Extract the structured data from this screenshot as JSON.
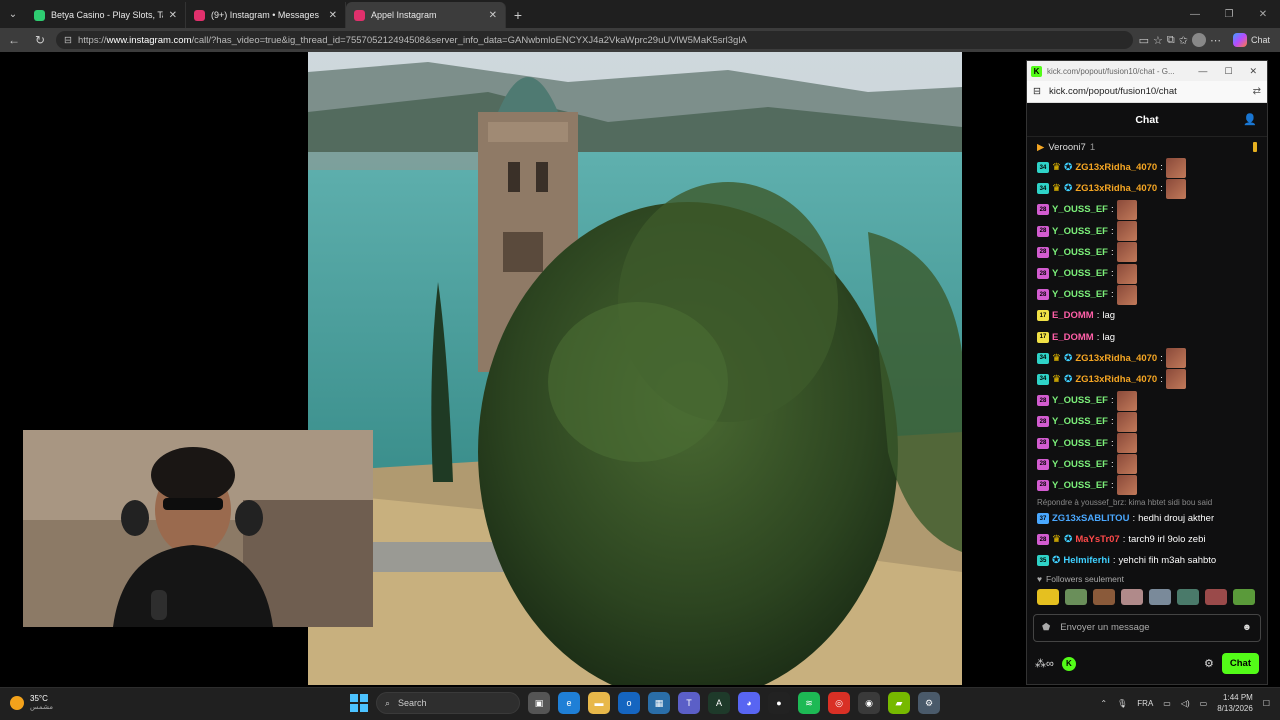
{
  "browser": {
    "tabs": [
      {
        "title": "Betya Casino - Play Slots, Table &",
        "favicon_color": "#2ecc71"
      },
      {
        "title": "(9+) Instagram • Messages",
        "favicon_color": "#e1306c"
      },
      {
        "title": "Appel Instagram",
        "favicon_color": "#e1306c"
      }
    ],
    "url_scheme": "https://",
    "url_host": "www.instagram.com",
    "url_path": "/call/?has_video=true&ig_thread_id=755705212494508&server_info_data=GANwbmloENCYXJ4a2VkaWprc29uUVlW5MaK5srl3glA",
    "copilot_label": "Chat"
  },
  "kick": {
    "window_title": "kick.com/popout/fusion10/chat - G...",
    "url": "kick.com/popout/fusion10/chat",
    "chat_title": "Chat",
    "pinned_user": "Verooni7",
    "pinned_count": "1",
    "messages": [
      {
        "badge": "34",
        "badge_color": "#2fd3c8",
        "crown": true,
        "shield": true,
        "user": "ZG13xRidha_4070",
        "color": "#f5a623",
        "text": "",
        "emote": true
      },
      {
        "badge": "34",
        "badge_color": "#2fd3c8",
        "crown": true,
        "shield": true,
        "user": "ZG13xRidha_4070",
        "color": "#f5a623",
        "text": "",
        "emote": true
      },
      {
        "badge": "28",
        "badge_color": "#d35cd0",
        "crown": false,
        "shield": false,
        "user": "Y_OUSS_EF",
        "color": "#7cf07a",
        "text": "",
        "emote": true
      },
      {
        "badge": "28",
        "badge_color": "#d35cd0",
        "crown": false,
        "shield": false,
        "user": "Y_OUSS_EF",
        "color": "#7cf07a",
        "text": "",
        "emote": true
      },
      {
        "badge": "28",
        "badge_color": "#d35cd0",
        "crown": false,
        "shield": false,
        "user": "Y_OUSS_EF",
        "color": "#7cf07a",
        "text": "",
        "emote": true
      },
      {
        "badge": "28",
        "badge_color": "#d35cd0",
        "crown": false,
        "shield": false,
        "user": "Y_OUSS_EF",
        "color": "#7cf07a",
        "text": "",
        "emote": true
      },
      {
        "badge": "28",
        "badge_color": "#d35cd0",
        "crown": false,
        "shield": false,
        "user": "Y_OUSS_EF",
        "color": "#7cf07a",
        "text": "",
        "emote": true
      },
      {
        "badge": "17",
        "badge_color": "#f0e046",
        "crown": false,
        "shield": false,
        "user": "E_DOMM",
        "color": "#ff5fa8",
        "text": "lag",
        "emote": false
      },
      {
        "badge": "17",
        "badge_color": "#f0e046",
        "crown": false,
        "shield": false,
        "user": "E_DOMM",
        "color": "#ff5fa8",
        "text": "lag",
        "emote": false
      },
      {
        "badge": "34",
        "badge_color": "#2fd3c8",
        "crown": true,
        "shield": true,
        "user": "ZG13xRidha_4070",
        "color": "#f5a623",
        "text": "",
        "emote": true
      },
      {
        "badge": "34",
        "badge_color": "#2fd3c8",
        "crown": true,
        "shield": true,
        "user": "ZG13xRidha_4070",
        "color": "#f5a623",
        "text": "",
        "emote": true
      },
      {
        "badge": "28",
        "badge_color": "#d35cd0",
        "crown": false,
        "shield": false,
        "user": "Y_OUSS_EF",
        "color": "#7cf07a",
        "text": "",
        "emote": true
      },
      {
        "badge": "28",
        "badge_color": "#d35cd0",
        "crown": false,
        "shield": false,
        "user": "Y_OUSS_EF",
        "color": "#7cf07a",
        "text": "",
        "emote": true
      },
      {
        "badge": "28",
        "badge_color": "#d35cd0",
        "crown": false,
        "shield": false,
        "user": "Y_OUSS_EF",
        "color": "#7cf07a",
        "text": "",
        "emote": true
      },
      {
        "badge": "28",
        "badge_color": "#d35cd0",
        "crown": false,
        "shield": false,
        "user": "Y_OUSS_EF",
        "color": "#7cf07a",
        "text": "",
        "emote": true
      },
      {
        "badge": "28",
        "badge_color": "#d35cd0",
        "crown": false,
        "shield": false,
        "user": "Y_OUSS_EF",
        "color": "#7cf07a",
        "text": "",
        "emote": true
      }
    ],
    "reply_line": "Répondre à youssef_brz: kima hbtet sidi bou said",
    "messages2": [
      {
        "badge": "37",
        "badge_color": "#4aa8ff",
        "crown": false,
        "shield": false,
        "user": "ZG13xSABLITOU",
        "color": "#4aa8ff",
        "text": "hedhi drouj akther",
        "emote": false
      },
      {
        "badge": "28",
        "badge_color": "#d35cd0",
        "crown": true,
        "shield": true,
        "user": "MaYsTr07",
        "color": "#ff4a4a",
        "text": "tarch9 irl 9olo zebi",
        "emote": false
      },
      {
        "badge": "35",
        "badge_color": "#2fd3c8",
        "crown": false,
        "shield": true,
        "user": "Helmiferhi",
        "color": "#3fd0ff",
        "text": "yehchi fih m3ah sahbto",
        "emote": false
      }
    ],
    "followers_label": "Followers seulement",
    "input_placeholder": "Envoyer un message",
    "chat_button": "Chat"
  },
  "taskbar": {
    "temperature": "35°C",
    "weather_desc": "مشمس",
    "search_placeholder": "Search",
    "language": "FRA",
    "time": "1:44 PM",
    "date": "8/13/2026"
  }
}
